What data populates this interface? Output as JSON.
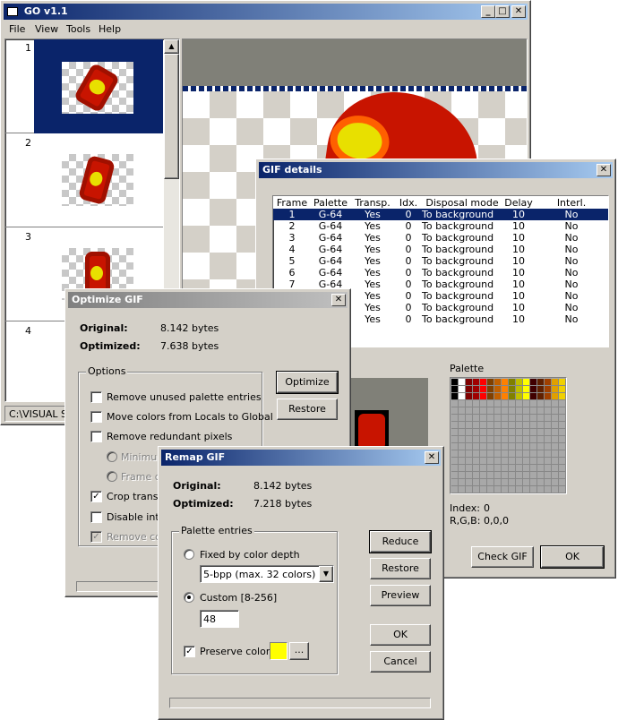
{
  "main": {
    "title": "GO v1.1",
    "menu": [
      "File",
      "View",
      "Tools",
      "Help"
    ],
    "frames": [
      "1",
      "2",
      "3",
      "4"
    ],
    "status": "C:\\VISUAL ST"
  },
  "gif_details": {
    "title": "GIF details",
    "columns": [
      "Frame",
      "Palette",
      "Transp.",
      "Idx.",
      "Disposal mode",
      "Delay",
      "Interl."
    ],
    "rows": [
      [
        "1",
        "G-64",
        "Yes",
        "0",
        "To background",
        "10",
        "No"
      ],
      [
        "2",
        "G-64",
        "Yes",
        "0",
        "To background",
        "10",
        "No"
      ],
      [
        "3",
        "G-64",
        "Yes",
        "0",
        "To background",
        "10",
        "No"
      ],
      [
        "4",
        "G-64",
        "Yes",
        "0",
        "To background",
        "10",
        "No"
      ],
      [
        "5",
        "G-64",
        "Yes",
        "0",
        "To background",
        "10",
        "No"
      ],
      [
        "6",
        "G-64",
        "Yes",
        "0",
        "To background",
        "10",
        "No"
      ],
      [
        "7",
        "G-64",
        "Yes",
        "0",
        "To background",
        "10",
        "No"
      ],
      [
        "8",
        "G-64",
        "Yes",
        "0",
        "To background",
        "10",
        "No"
      ],
      [
        "9",
        "G-64",
        "Yes",
        "0",
        "To background",
        "10",
        "No"
      ],
      [
        "10",
        "G-64",
        "Yes",
        "0",
        "To background",
        "10",
        "No"
      ]
    ],
    "palette_label": "Palette",
    "index_label": "Index:",
    "index_value": "0",
    "rgb_label": "R,G,B:",
    "rgb_value": "0,0,0",
    "check_gif": "Check GIF",
    "ok": "OK",
    "palette_colors": [
      "#000000",
      "#ffffff",
      "#800000",
      "#a00000",
      "#ff0000",
      "#804000",
      "#c06000",
      "#ff8000",
      "#808000",
      "#c0c000",
      "#ffff00",
      "#400000",
      "#602000",
      "#a04000",
      "#e0a000",
      "#f0d000"
    ]
  },
  "optimize": {
    "title": "Optimize GIF",
    "original_label": "Original:",
    "original_value": "8.142 bytes",
    "optimized_label": "Optimized:",
    "optimized_value": "7.638 bytes",
    "options_label": "Options",
    "opt1": "Remove unused palette entries",
    "opt2": "Move colors from Locals to Global",
    "opt3": "Remove redundant pixels",
    "sub1": "Minimum",
    "sub2": "Frame di",
    "opt4": "Crop transpa",
    "opt5": "Disable inter",
    "opt6": "Remove com",
    "optimize_btn": "Optimize",
    "restore_btn": "Restore"
  },
  "remap": {
    "title": "Remap GIF",
    "original_label": "Original:",
    "original_value": "8.142 bytes",
    "optimized_label": "Optimized:",
    "optimized_value": "7.218 bytes",
    "palette_entries": "Palette entries",
    "fixed_label": "Fixed by color depth",
    "depth_value": "5-bpp (max. 32 colors)",
    "custom_label": "Custom [8-256]",
    "custom_value": "48",
    "preserve_label": "Preserve color",
    "ellipsis": "...",
    "reduce_btn": "Reduce",
    "restore_btn": "Restore",
    "preview_btn": "Preview",
    "ok_btn": "OK",
    "cancel_btn": "Cancel",
    "preserve_color": "#ffff00"
  }
}
